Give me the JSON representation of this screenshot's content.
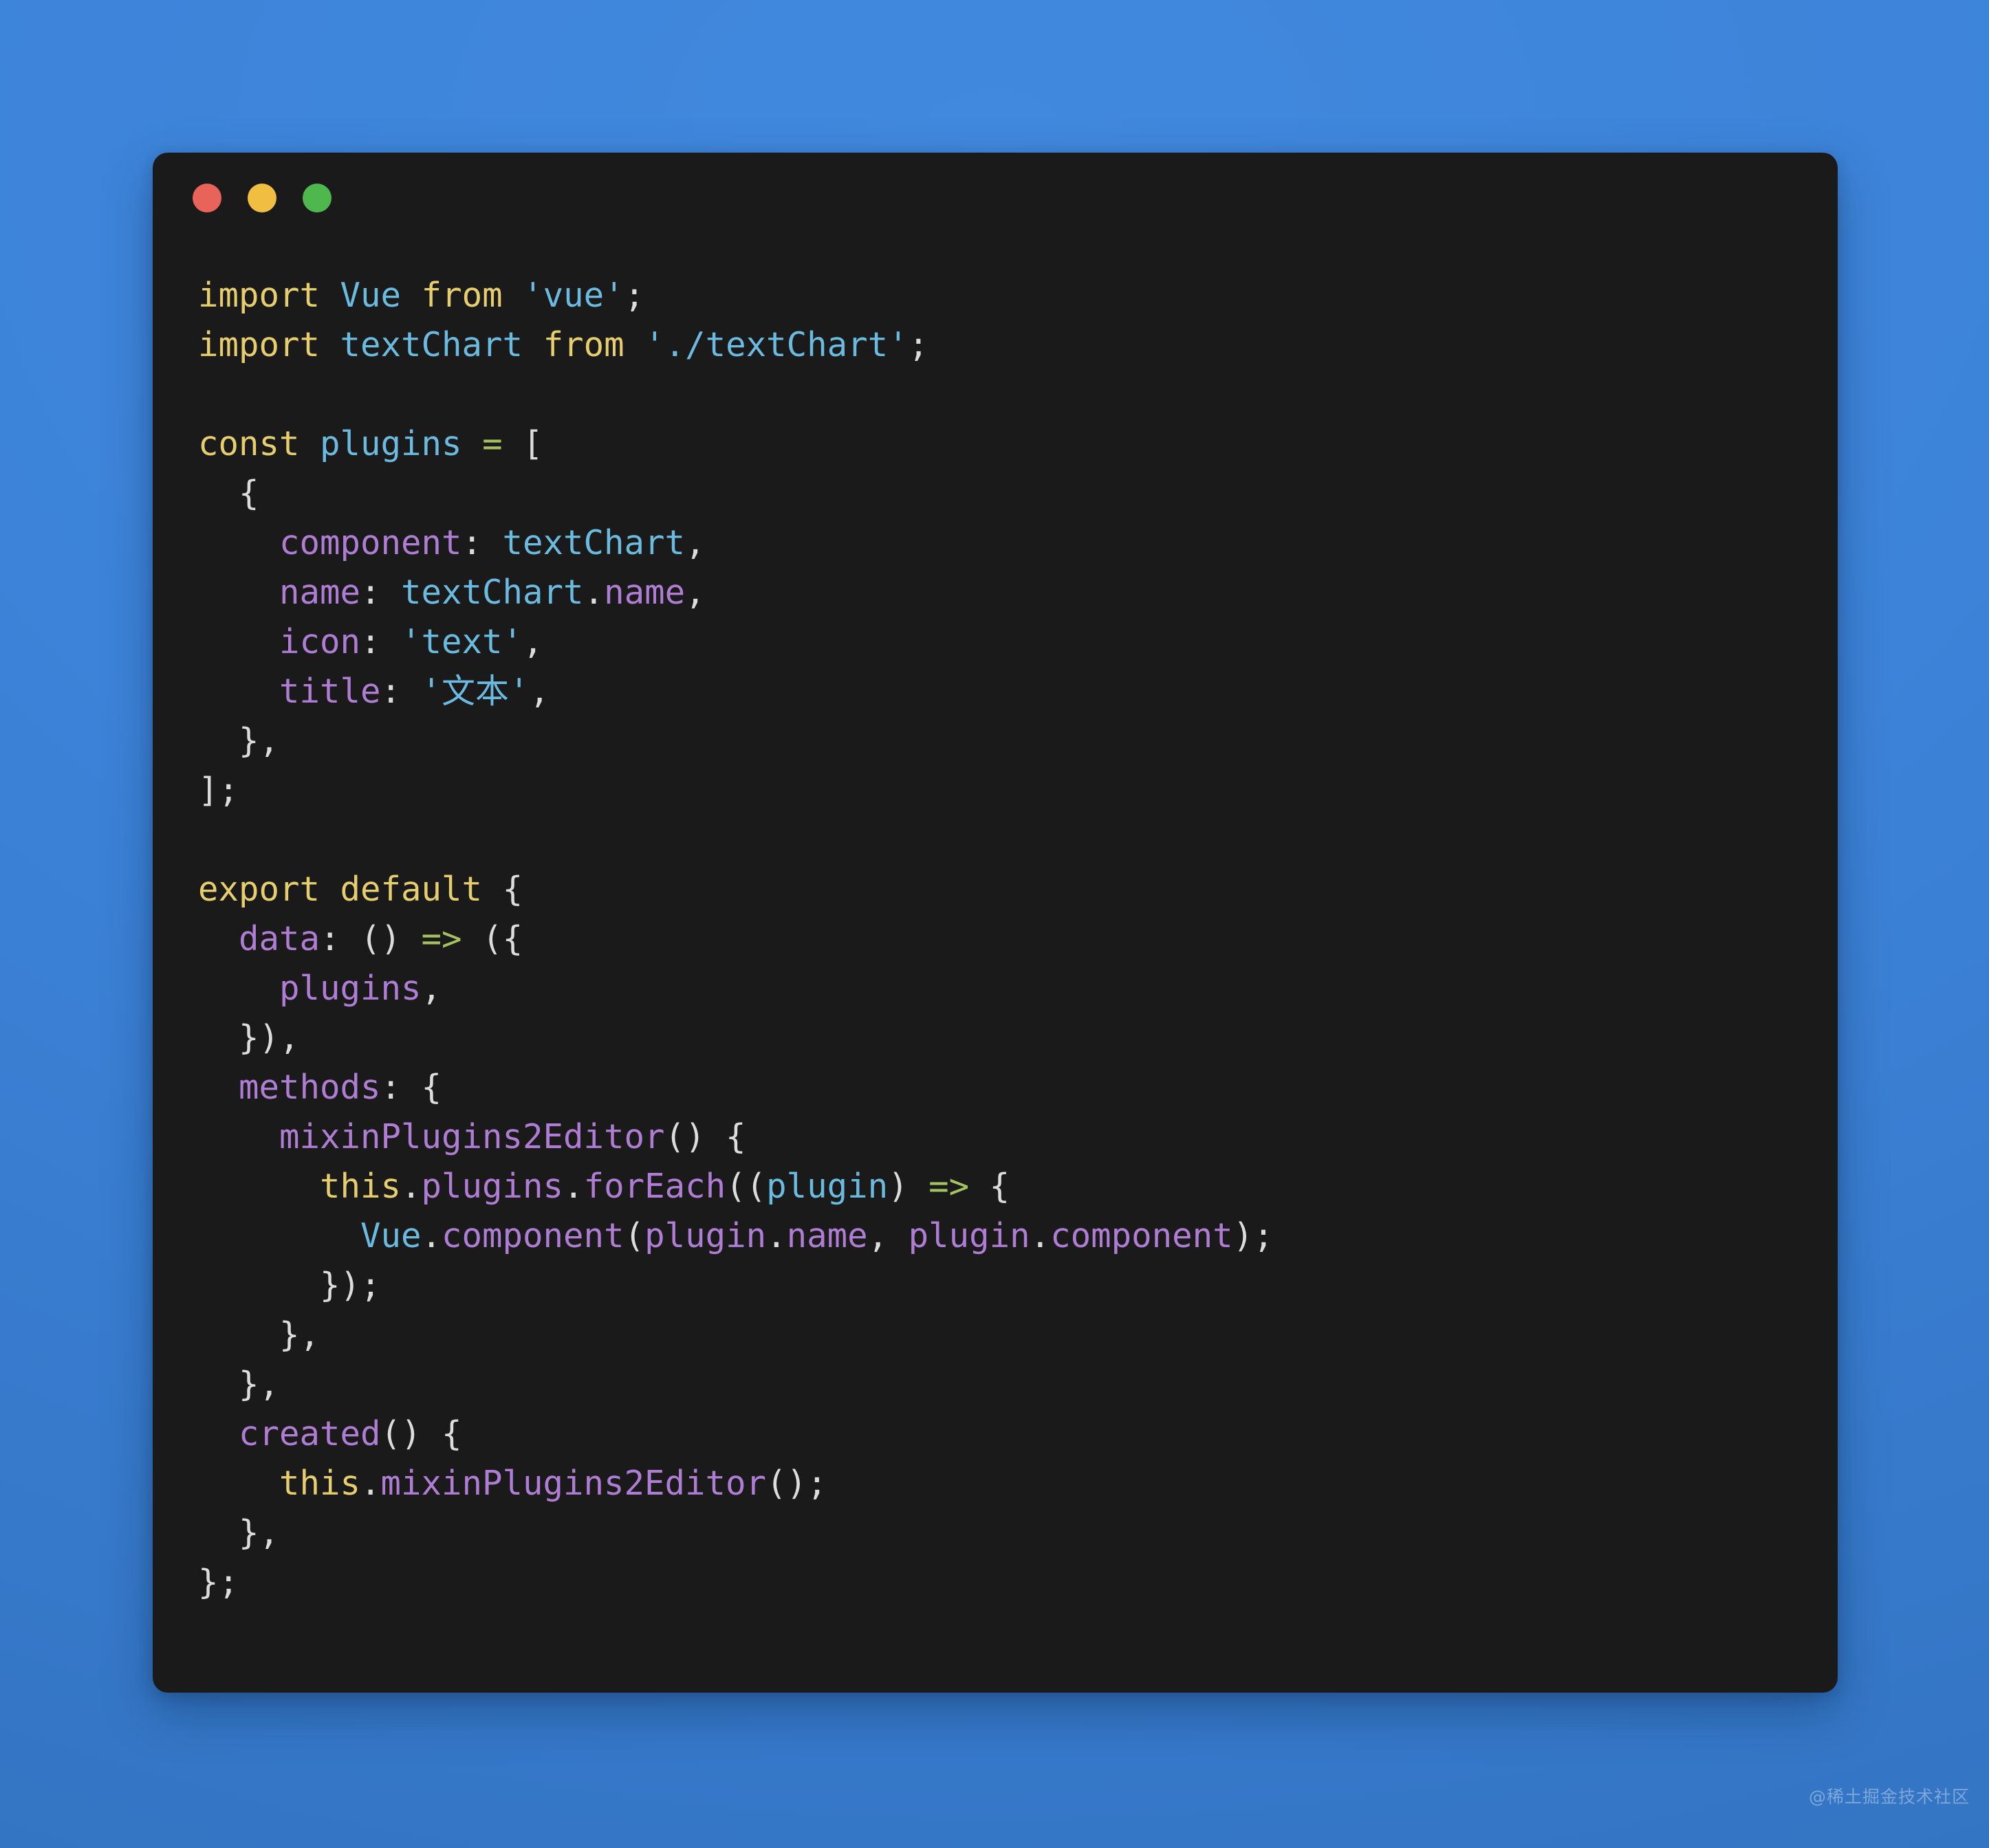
{
  "window": {
    "traffic_lights": [
      {
        "name": "close",
        "color": "#e8635a"
      },
      {
        "name": "minimize",
        "color": "#f0be40"
      },
      {
        "name": "zoom",
        "color": "#4eb84e"
      }
    ],
    "background_color": "#1a1a1a"
  },
  "backdrop": {
    "color": "#3b83da"
  },
  "theme": {
    "keyword": "#e6ce6e",
    "identifier": "#6bbbe0",
    "string": "#6bbbe0",
    "property": "#b07dd4",
    "operator": "#a5c261",
    "punctuation": "#dcdcdc"
  },
  "code": {
    "language": "javascript",
    "lines": [
      "import Vue from 'vue';",
      "import textChart from './textChart';",
      "",
      "const plugins = [",
      "  {",
      "    component: textChart,",
      "    name: textChart.name,",
      "    icon: 'text',",
      "    title: '文本',",
      "  },",
      "];",
      "",
      "export default {",
      "  data: () => ({",
      "    plugins,",
      "  }),",
      "  methods: {",
      "    mixinPlugins2Editor() {",
      "      this.plugins.forEach((plugin) => {",
      "        Vue.component(plugin.name, plugin.component);",
      "      });",
      "    },",
      "  },",
      "  created() {",
      "    this.mixinPlugins2Editor();",
      "  },",
      "};"
    ],
    "tokens": {
      "l1": {
        "kw1": "import",
        "id1": "Vue",
        "kw2": "from",
        "str1": "'vue'",
        "pn1": ";"
      },
      "l2": {
        "kw1": "import",
        "id1": "textChart",
        "kw2": "from",
        "str1": "'./textChart'",
        "pn1": ";"
      },
      "l4": {
        "kw1": "const",
        "id1": "plugins",
        "op1": "=",
        "pn1": "["
      },
      "l5": {
        "pn1": "{"
      },
      "l6": {
        "prop1": "component",
        "pn1": ": ",
        "id1": "textChart",
        "pn2": ","
      },
      "l7": {
        "prop1": "name",
        "pn1": ": ",
        "id1": "textChart",
        "pn2": ".",
        "prop2": "name",
        "pn3": ","
      },
      "l8": {
        "prop1": "icon",
        "pn1": ": ",
        "str1": "'text'",
        "pn2": ","
      },
      "l9": {
        "prop1": "title",
        "pn1": ": ",
        "str1": "'文本'",
        "pn2": ","
      },
      "l10": {
        "pn1": "},"
      },
      "l11": {
        "pn1": "];"
      },
      "l13": {
        "kw1": "export",
        "kw2": "default",
        "pn1": "{"
      },
      "l14": {
        "prop1": "data",
        "pn1": ": () ",
        "op1": "=>",
        "pn2": " ({"
      },
      "l15": {
        "prop1": "plugins",
        "pn1": ","
      },
      "l16": {
        "pn1": "}),"
      },
      "l17": {
        "prop1": "methods",
        "pn1": ": {"
      },
      "l18": {
        "prop1": "mixinPlugins2Editor",
        "pn1": "() {"
      },
      "l19": {
        "kw1": "this",
        "pn1": ".",
        "prop1": "plugins",
        "pn2": ".",
        "prop2": "forEach",
        "pn3": "((",
        "id1": "plugin",
        "pn4": ") ",
        "op1": "=>",
        "pn5": " {"
      },
      "l20": {
        "id1": "Vue",
        "pn1": ".",
        "prop1": "component",
        "pn2": "(",
        "prop2": "plugin",
        "pn3": ".",
        "prop3": "name",
        "pn4": ", ",
        "prop4": "plugin",
        "pn5": ".",
        "prop5": "component",
        "pn6": ");"
      },
      "l21": {
        "pn1": "});"
      },
      "l22": {
        "pn1": "},"
      },
      "l23": {
        "pn1": "},"
      },
      "l24": {
        "prop1": "created",
        "pn1": "() {"
      },
      "l25": {
        "kw1": "this",
        "pn1": ".",
        "prop1": "mixinPlugins2Editor",
        "pn2": "();"
      },
      "l26": {
        "pn1": "},"
      },
      "l27": {
        "pn1": "};"
      }
    }
  },
  "watermark": {
    "text": "@稀土掘金技术社区"
  }
}
